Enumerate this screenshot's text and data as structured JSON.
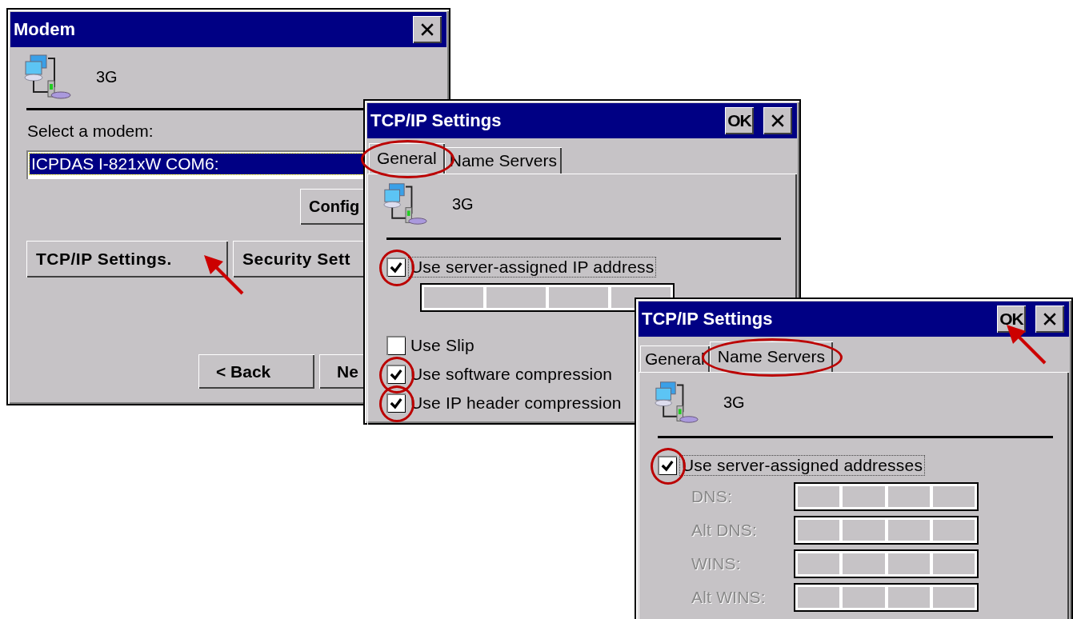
{
  "modem_window": {
    "title": "Modem",
    "device_name": "3G",
    "select_label": "Select a modem:",
    "selected_modem": "ICPDAS I-821xW COM6:",
    "config_button": {
      "label": "Config"
    },
    "settings_buttons": [
      {
        "label": "TCP/IP Settings.",
        "pointed": true
      },
      {
        "label": "Security Sett",
        "pointed": false
      }
    ],
    "nav_buttons": [
      {
        "label": "< Back"
      },
      {
        "label": "Ne"
      }
    ]
  },
  "tcpip_windows": [
    {
      "title": "TCP/IP Settings",
      "ok_button": {
        "label": "OK",
        "pointed": false
      },
      "tabs": [
        {
          "label": "General",
          "selected": true,
          "circled": true
        },
        {
          "label": "Name Servers",
          "selected": false,
          "circled": false
        }
      ],
      "device_name": "3G",
      "rows": [
        {
          "kind": "checkbox",
          "label": "Use server-assigned IP address",
          "checked": true,
          "circled": true,
          "focused": true
        },
        {
          "kind": "ip-field"
        },
        {
          "kind": "checkbox",
          "label": "Use Slip",
          "checked": false,
          "circled": false,
          "focused": false
        },
        {
          "kind": "checkbox",
          "label": "Use software compression",
          "checked": true,
          "circled": true,
          "focused": false
        },
        {
          "kind": "checkbox",
          "label": "Use IP header compression",
          "checked": true,
          "circled": true,
          "focused": false
        }
      ]
    },
    {
      "title": "TCP/IP Settings",
      "ok_button": {
        "label": "OK",
        "pointed": true
      },
      "tabs": [
        {
          "label": "General",
          "selected": false,
          "circled": false
        },
        {
          "label": "Name Servers",
          "selected": true,
          "circled": true
        }
      ],
      "device_name": "3G",
      "rows": [
        {
          "kind": "checkbox",
          "label": "Use server-assigned addresses",
          "checked": true,
          "circled": true,
          "focused": true
        },
        {
          "kind": "address-field",
          "label": "DNS:",
          "disabled": true
        },
        {
          "kind": "address-field",
          "label": "Alt DNS:",
          "disabled": true
        },
        {
          "kind": "address-field",
          "label": "WINS:",
          "disabled": true
        },
        {
          "kind": "address-field",
          "label": "Alt WINS:",
          "disabled": true
        }
      ]
    }
  ]
}
